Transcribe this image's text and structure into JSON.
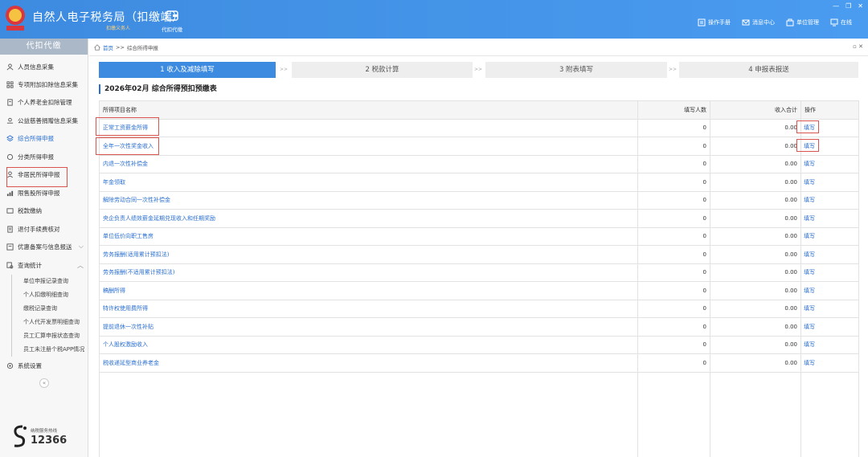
{
  "header": {
    "title": "自然人电子税务局（扣缴端）",
    "subtitle": "扣缴义务人",
    "module": "代扣代缴",
    "links": [
      {
        "label": "操作手册",
        "icon": "manual-icon"
      },
      {
        "label": "消息中心",
        "icon": "message-icon"
      },
      {
        "label": "单位管理",
        "icon": "org-icon"
      },
      {
        "label": "在线",
        "icon": "online-icon"
      }
    ],
    "colors": {
      "primary": "#3d8be0",
      "highlight": "#d9534f",
      "link": "#2a6fd0"
    }
  },
  "sidebar": {
    "title": "代扣代缴",
    "items": [
      {
        "label": "人员信息采集",
        "icon": "person-icon"
      },
      {
        "label": "专项附加扣除信息采集",
        "icon": "grid-icon"
      },
      {
        "label": "个人养老金扣除管理",
        "icon": "doc-icon"
      },
      {
        "label": "公益慈善捐赠信息采集",
        "icon": "donate-icon"
      },
      {
        "label": "综合所得申报",
        "icon": "layers-icon"
      },
      {
        "label": "分类所得申报",
        "icon": "refresh-icon"
      },
      {
        "label": "非居民所得申报",
        "icon": "user-icon"
      },
      {
        "label": "限售股所得申报",
        "icon": "bar-icon"
      },
      {
        "label": "税款缴纳",
        "icon": "wallet-icon"
      },
      {
        "label": "退付手续费核对",
        "icon": "list-icon"
      },
      {
        "label": "优惠备案与信息报送",
        "icon": "form-icon"
      },
      {
        "label": "查询统计",
        "icon": "search-doc-icon"
      }
    ],
    "sub_items": [
      "单位申报记录查询",
      "个人扣缴明细查询",
      "缴税记录查询",
      "个人代开发票明细查询",
      "员工汇算申报状态查询",
      "员工未注册个税APP情况"
    ],
    "settings": "系统设置",
    "hotline_label": "纳税服务热线",
    "hotline_number": "12366"
  },
  "breadcrumb": {
    "home": "首页",
    "sep": ">>",
    "current": "综合所得申报"
  },
  "steps": [
    "1 收入及减除填写",
    "2 税款计算",
    "3 附表填写",
    "4 申报表报送"
  ],
  "step_sep": ">>",
  "section_title": "2026年02月  综合所得预扣预缴表",
  "table": {
    "headers": [
      "所得项目名称",
      "填写人数",
      "收入合计",
      "操作"
    ],
    "rows": [
      {
        "name": "正常工资薪金所得",
        "count": "0",
        "total": "0.00",
        "op": "填写"
      },
      {
        "name": "全年一次性奖金收入",
        "count": "0",
        "total": "0.00",
        "op": "填写"
      },
      {
        "name": "内退一次性补偿金",
        "count": "0",
        "total": "0.00",
        "op": "填写"
      },
      {
        "name": "年金领取",
        "count": "0",
        "total": "0.00",
        "op": "填写"
      },
      {
        "name": "解除劳动合同一次性补偿金",
        "count": "0",
        "total": "0.00",
        "op": "填写"
      },
      {
        "name": "央企负责人绩效薪金延期兑现收入和任期奖励",
        "count": "0",
        "total": "0.00",
        "op": "填写"
      },
      {
        "name": "单位低价向职工售房",
        "count": "0",
        "total": "0.00",
        "op": "填写"
      },
      {
        "name": "劳务报酬(适用累计预扣法)",
        "count": "0",
        "total": "0.00",
        "op": "填写"
      },
      {
        "name": "劳务报酬(不适用累计预扣法)",
        "count": "0",
        "total": "0.00",
        "op": "填写"
      },
      {
        "name": "稿酬所得",
        "count": "0",
        "total": "0.00",
        "op": "填写"
      },
      {
        "name": "特许权使用费所得",
        "count": "0",
        "total": "0.00",
        "op": "填写"
      },
      {
        "name": "提前退休一次性补贴",
        "count": "0",
        "total": "0.00",
        "op": "填写"
      },
      {
        "name": "个人股权激励收入",
        "count": "0",
        "total": "0.00",
        "op": "填写"
      },
      {
        "name": "税收递延型商业养老金",
        "count": "0",
        "total": "0.00",
        "op": "填写"
      }
    ]
  }
}
